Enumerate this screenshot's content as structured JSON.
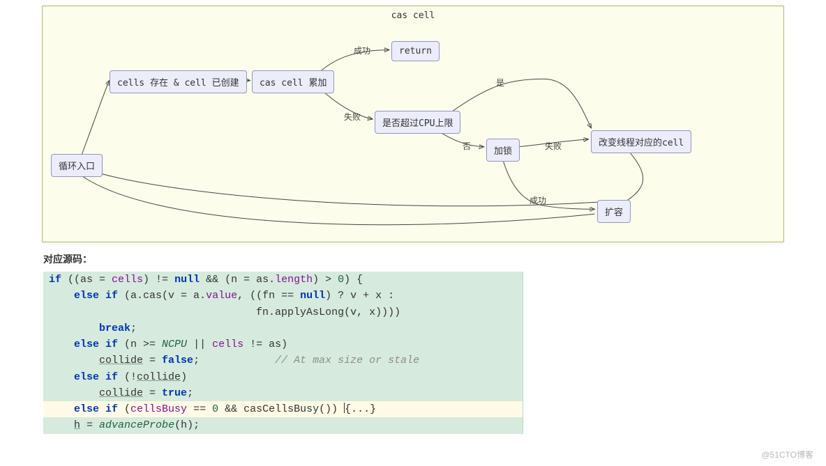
{
  "diagram": {
    "title": "cas cell",
    "nodes": {
      "loop_entry": "循环入口",
      "cells_exist": "cells 存在 & cell 已创建",
      "cas_cell": "cas cell 累加",
      "return": "return",
      "cpu_limit": "是否超过CPU上限",
      "lock": "加锁",
      "change_cell": "改变线程对应的cell",
      "expand": "扩容"
    },
    "labels": {
      "success1": "成功",
      "fail1": "失败",
      "yes": "是",
      "no": "否",
      "fail2": "失败",
      "success2": "成功"
    }
  },
  "section_header": "对应源码：",
  "code": {
    "l1": "if ((as = cells) != null && (n = as.length) > 0) {",
    "l2": "    else if (a.cas(v = a.value, ((fn == null) ? v + x :",
    "l3": "                                 fn.applyAsLong(v, x))))",
    "l4": "        break;",
    "l5": "    else if (n >= NCPU || cells != as)",
    "l6": "        collide = false;            // At max size or stale",
    "l7": "    else if (!collide)",
    "l8": "        collide = true;",
    "l9": "    else if (cellsBusy == 0 && casCellsBusy()) {...}",
    "l10": "    h = advanceProbe(h);",
    "cursor": "|"
  },
  "watermark": "@51CTO博客"
}
